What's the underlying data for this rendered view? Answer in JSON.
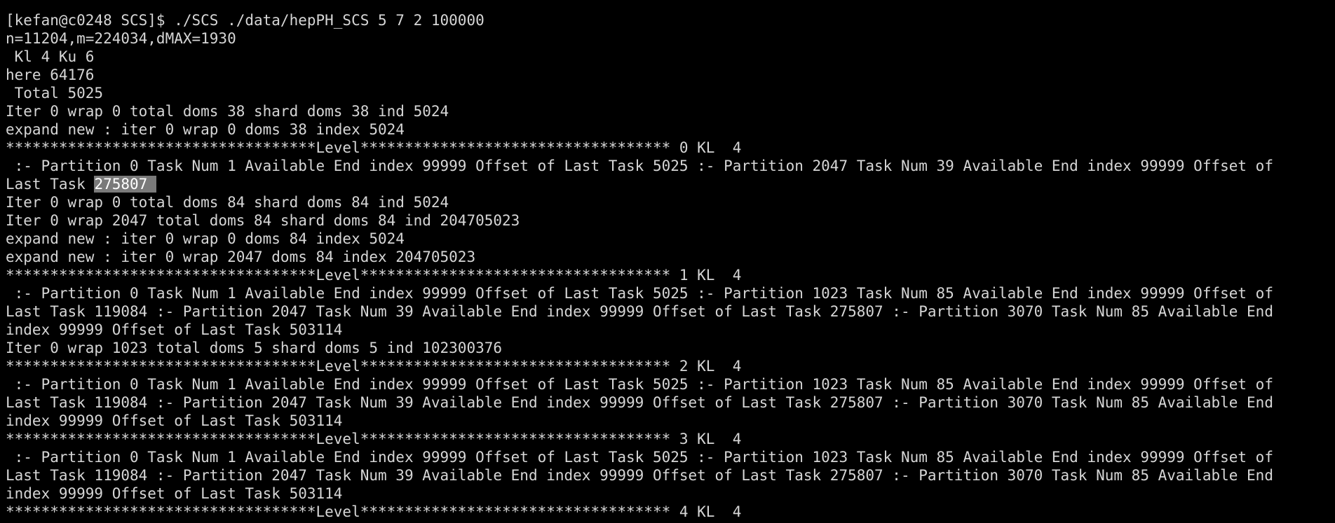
{
  "terminal": {
    "colors": {
      "background": "#000000",
      "foreground": "#d6d6d6",
      "selection": "#7a7a7a"
    },
    "selected_text": "275807 ",
    "lines": [
      "[kefan@c0248 SCS]$ ./SCS ./data/hepPH_SCS 5 7 2 100000",
      "n=11204,m=224034,dMAX=1930",
      " Kl 4 Ku 6",
      "here 64176",
      " Total 5025",
      "Iter 0 wrap 0 total doms 38 shard doms 38 ind 5024",
      "expand new : iter 0 wrap 0 doms 38 index 5024",
      "***********************************Level*********************************** 0 KL  4",
      " :- Partition 0 Task Num 1 Available End index 99999 Offset of Last Task 5025 :- Partition 2047 Task Num 39 Available End index 99999 Offset of",
      "Last Task ",
      "Iter 0 wrap 0 total doms 84 shard doms 84 ind 5024",
      "Iter 0 wrap 2047 total doms 84 shard doms 84 ind 204705023",
      "expand new : iter 0 wrap 0 doms 84 index 5024",
      "expand new : iter 0 wrap 2047 doms 84 index 204705023",
      "***********************************Level*********************************** 1 KL  4",
      " :- Partition 0 Task Num 1 Available End index 99999 Offset of Last Task 5025 :- Partition 1023 Task Num 85 Available End index 99999 Offset of",
      "Last Task 119084 :- Partition 2047 Task Num 39 Available End index 99999 Offset of Last Task 275807 :- Partition 3070 Task Num 85 Available End",
      "index 99999 Offset of Last Task 503114",
      "Iter 0 wrap 1023 total doms 5 shard doms 5 ind 102300376",
      "***********************************Level*********************************** 2 KL  4",
      " :- Partition 0 Task Num 1 Available End index 99999 Offset of Last Task 5025 :- Partition 1023 Task Num 85 Available End index 99999 Offset of",
      "Last Task 119084 :- Partition 2047 Task Num 39 Available End index 99999 Offset of Last Task 275807 :- Partition 3070 Task Num 85 Available End",
      "index 99999 Offset of Last Task 503114",
      "***********************************Level*********************************** 3 KL  4",
      " :- Partition 0 Task Num 1 Available End index 99999 Offset of Last Task 5025 :- Partition 1023 Task Num 85 Available End index 99999 Offset of",
      "Last Task 119084 :- Partition 2047 Task Num 39 Available End index 99999 Offset of Last Task 275807 :- Partition 3070 Task Num 85 Available End",
      "index 99999 Offset of Last Task 503114",
      "***********************************Level*********************************** 4 KL  4"
    ]
  }
}
